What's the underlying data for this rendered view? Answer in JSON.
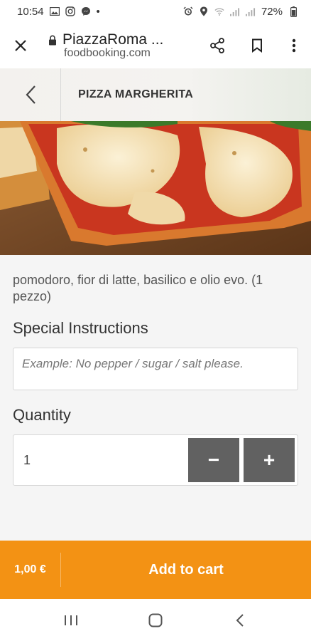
{
  "status_bar": {
    "time": "10:54",
    "dot": "•",
    "battery": "72%",
    "left_icons": [
      "image-icon",
      "instagram-icon",
      "messenger-icon"
    ],
    "right_icons": [
      "alarm-icon",
      "location-icon",
      "wifi-icon",
      "signal-icon",
      "signal-icon"
    ]
  },
  "browser": {
    "title": "PiazzaRoma ...",
    "domain": "foodbooking.com"
  },
  "product": {
    "name": "PIZZA MARGHERITA",
    "description": "pomodoro, fior di latte, basilico e olio evo. (1 pezzo)"
  },
  "special_instructions": {
    "label": "Special Instructions",
    "placeholder": "Example: No pepper / sugar / salt please.",
    "value": ""
  },
  "quantity": {
    "label": "Quantity",
    "value": "1",
    "minus": "−",
    "plus": "+"
  },
  "cart": {
    "price": "1,00 €",
    "button_label": "Add to cart"
  },
  "colors": {
    "accent": "#f39214",
    "button_gray": "#616161",
    "background": "#f5f5f5"
  }
}
